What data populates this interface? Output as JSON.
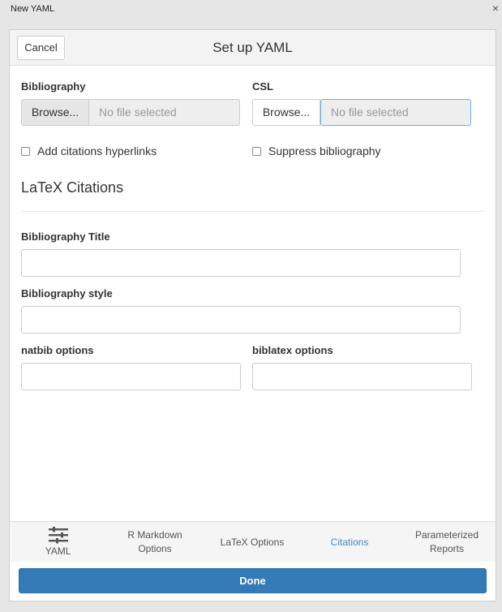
{
  "window": {
    "title": "New YAML",
    "close_glyph": "×"
  },
  "header": {
    "title": "Set up YAML",
    "cancel_label": "Cancel"
  },
  "bibliography": {
    "label": "Bibliography",
    "browse_label": "Browse...",
    "file_text": "No file selected"
  },
  "csl": {
    "label": "CSL",
    "browse_label": "Browse...",
    "file_text": "No file selected"
  },
  "checkboxes": {
    "add_citations": {
      "label": "Add citations hyperlinks",
      "checked": false
    },
    "suppress_bib": {
      "label": "Suppress bibliography",
      "checked": false
    }
  },
  "latex": {
    "section_title": "LaTeX Citations",
    "bib_title_label": "Bibliography Title",
    "bib_title_value": "",
    "bib_style_label": "Bibliography style",
    "bib_style_value": "",
    "natbib_label": "natbib options",
    "natbib_value": "",
    "biblatex_label": "biblatex options",
    "biblatex_value": ""
  },
  "tabs": [
    {
      "label": "YAML",
      "icon": "sliders-icon",
      "active": false
    },
    {
      "label_line1": "R Markdown",
      "label_line2": "Options",
      "active": false
    },
    {
      "label": "LaTeX Options",
      "active": false
    },
    {
      "label": "Citations",
      "active": true
    },
    {
      "label_line1": "Parameterized",
      "label_line2": "Reports",
      "active": false
    }
  ],
  "footer": {
    "done_label": "Done"
  },
  "colors": {
    "accent": "#337ab7",
    "active_tab": "#3c8dbc"
  }
}
